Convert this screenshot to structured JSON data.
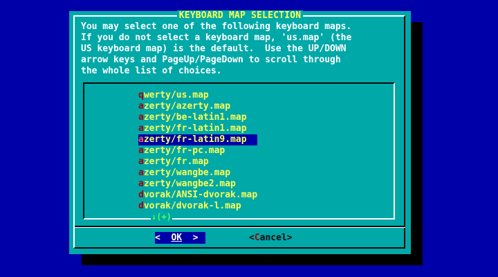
{
  "dialog": {
    "title": "KEYBOARD MAP SELECTION",
    "description": [
      "You may select one of the following keyboard maps.",
      "If you do not select a keyboard map, 'us.map' (the",
      "US keyboard map) is the default.  Use the UP/DOWN",
      "arrow keys and PageUp/PageDown to scroll through",
      "the whole list of choices."
    ],
    "items": [
      {
        "hot": "q",
        "rest": "werty/us.map"
      },
      {
        "hot": "a",
        "rest": "zerty/azerty.map"
      },
      {
        "hot": "a",
        "rest": "zerty/be-latin1.map"
      },
      {
        "hot": "a",
        "rest": "zerty/fr-latin1.map"
      },
      {
        "hot": "a",
        "rest": "zerty/fr-latin9.map"
      },
      {
        "hot": "a",
        "rest": "zerty/fr-pc.map"
      },
      {
        "hot": "a",
        "rest": "zerty/fr.map"
      },
      {
        "hot": "a",
        "rest": "zerty/wangbe.map"
      },
      {
        "hot": "a",
        "rest": "zerty/wangbe2.map"
      },
      {
        "hot": "d",
        "rest": "vorak/ANSI-dvorak.map"
      },
      {
        "hot": "d",
        "rest": "vorak/dvorak-l.map"
      }
    ],
    "selected_index": 4,
    "more_indicator": "↓(+)",
    "buttons": {
      "ok": {
        "left": "<",
        "label": "OK",
        "right": ">"
      },
      "cancel": {
        "left": "<",
        "hot": "C",
        "rest": "ancel",
        "right": ">"
      }
    }
  },
  "colors": {
    "background": "#0000a8",
    "dialog": "#00a8a8",
    "title": "#ffff54",
    "item_text": "#ffff54",
    "hotkey": "#a80000",
    "selection": "#0000a8",
    "more": "#54ff54"
  }
}
